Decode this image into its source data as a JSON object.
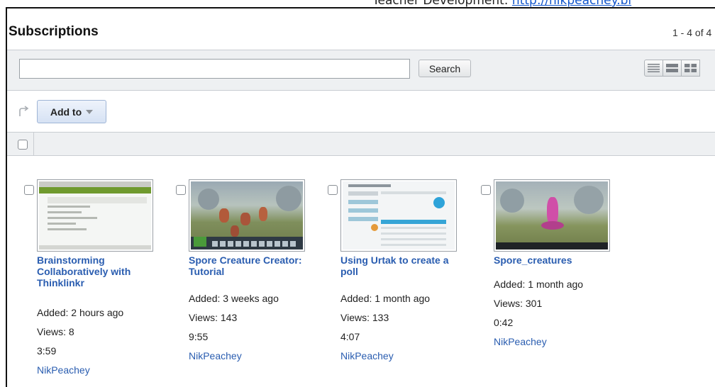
{
  "banner": {
    "text": "Teacher Development: ",
    "link_text": "http://nikpeachey.bl"
  },
  "page": {
    "title": "Subscriptions",
    "pager": "1 - 4 of 4"
  },
  "search": {
    "value": "",
    "placeholder": "",
    "button_label": "Search"
  },
  "view_toggles": [
    {
      "name": "list-view-icon"
    },
    {
      "name": "compact-view-icon"
    },
    {
      "name": "grid-view-icon"
    }
  ],
  "actions": {
    "add_to_label": "Add to"
  },
  "videos": [
    {
      "title": "Brainstorming Collaboratively with Thinklinkr",
      "added": "Added: 2 hours ago",
      "views": "Views: 8",
      "duration": "3:59",
      "author": "NikPeachey"
    },
    {
      "title": "Spore Creature Creator: Tutorial",
      "added": "Added: 3 weeks ago",
      "views": "Views: 143",
      "duration": "9:55",
      "author": "NikPeachey"
    },
    {
      "title": "Using Urtak to create a poll",
      "added": "Added: 1 month ago",
      "views": "Views: 133",
      "duration": "4:07",
      "author": "NikPeachey"
    },
    {
      "title": "Spore_creatures",
      "added": "Added: 1 month ago",
      "views": "Views: 301",
      "duration": "0:42",
      "author": "NikPeachey"
    }
  ],
  "colors": {
    "link_blue": "#2a5db0",
    "toolbar_gray": "#eef0f2",
    "add_to_blue": "#d6e2f4"
  }
}
